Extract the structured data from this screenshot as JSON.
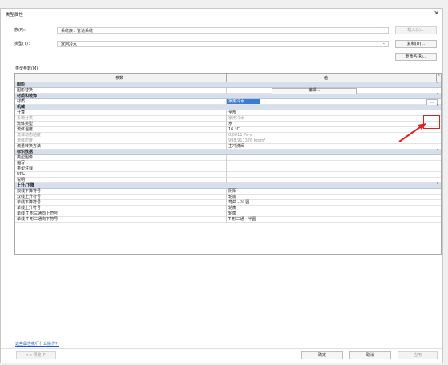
{
  "title": "类型属性",
  "family_label": "族(F)：",
  "family_value": "系统族：管道系统",
  "load_button": "载入(L)...",
  "type_label": "类型(T)：",
  "type_value": "家用冷水",
  "duplicate_button": "复制(D)...",
  "rename_button": "重命名(R)...",
  "type_params_label": "类型参数(M)",
  "col_param": "参数",
  "col_value": "值",
  "groups": [
    {
      "name": "图形",
      "rows": [
        {
          "k": "图形替换",
          "v": "",
          "button": "编辑..."
        }
      ]
    },
    {
      "name": "材质和装饰",
      "rows": [
        {
          "k": "材质",
          "v": "家用冷水",
          "selected": true,
          "dots": "..."
        }
      ]
    },
    {
      "name": "机械",
      "rows": [
        {
          "k": "计算",
          "v": "全部"
        },
        {
          "k": "系统分类",
          "v": "家用冷水",
          "ro": true
        },
        {
          "k": "流体类型",
          "v": "水"
        },
        {
          "k": "流体温度",
          "v": "16 °C"
        },
        {
          "k": "流体动态粘度",
          "v": "0.0011 Pa-s",
          "ro": true
        },
        {
          "k": "流体密度",
          "v": "998.911376 kg/m³",
          "ro": true
        },
        {
          "k": "流量转换方法",
          "v": "主冲洗阀"
        }
      ]
    },
    {
      "name": "标识数据",
      "rows": [
        {
          "k": "类型图像",
          "v": ""
        },
        {
          "k": "缩写",
          "v": ""
        },
        {
          "k": "类型注释",
          "v": ""
        },
        {
          "k": "URL",
          "v": ""
        },
        {
          "k": "说明",
          "v": ""
        }
      ]
    },
    {
      "name": "上升/下降",
      "rows": [
        {
          "k": "双线下降符号",
          "v": "阴阳"
        },
        {
          "k": "双线上升符号",
          "v": "轮廓"
        },
        {
          "k": "单线下降符号",
          "v": "弯曲 - ¾ 圆"
        },
        {
          "k": "单线上升符号",
          "v": "轮廓"
        },
        {
          "k": "单线 T 形三通向上符号",
          "v": "轮廓"
        },
        {
          "k": "单线 T 形三通向下符号",
          "v": "T 形三通 - 半圆"
        }
      ]
    }
  ],
  "help_link": "这些属性执行什么操作？",
  "preview_button": "<< 预览(P)",
  "ok_button": "确定",
  "cancel_button": "取消",
  "apply_button": "应用"
}
